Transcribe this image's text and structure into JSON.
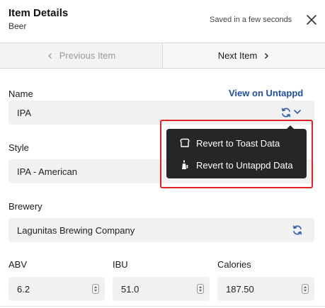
{
  "header": {
    "title": "Item Details",
    "subtitle": "Beer",
    "saved_text": "Saved in a few seconds",
    "close_icon": "close-icon"
  },
  "navigation": {
    "previous_label": "Previous Item",
    "next_label": "Next Item"
  },
  "fields": {
    "name": {
      "label": "Name",
      "value": "IPA",
      "link_label": "View on Untappd"
    },
    "style": {
      "label": "Style",
      "value": "IPA - American"
    },
    "brewery": {
      "label": "Brewery",
      "value": "Lagunitas Brewing Company"
    },
    "abv": {
      "label": "ABV",
      "value": "6.2"
    },
    "ibu": {
      "label": "IBU",
      "value": "51.0"
    },
    "calories": {
      "label": "Calories",
      "value": "187.50"
    }
  },
  "revert_menu": {
    "items": [
      {
        "label": "Revert to Toast Data",
        "icon": "toast-icon"
      },
      {
        "label": "Revert to Untappd Data",
        "icon": "untappd-icon"
      }
    ]
  },
  "colors": {
    "link": "#1f4fa3",
    "sync_icon": "#2a5db0",
    "menu_bg": "#262626",
    "highlight_outline": "#e02424",
    "field_bg": "#f1f1f1"
  }
}
